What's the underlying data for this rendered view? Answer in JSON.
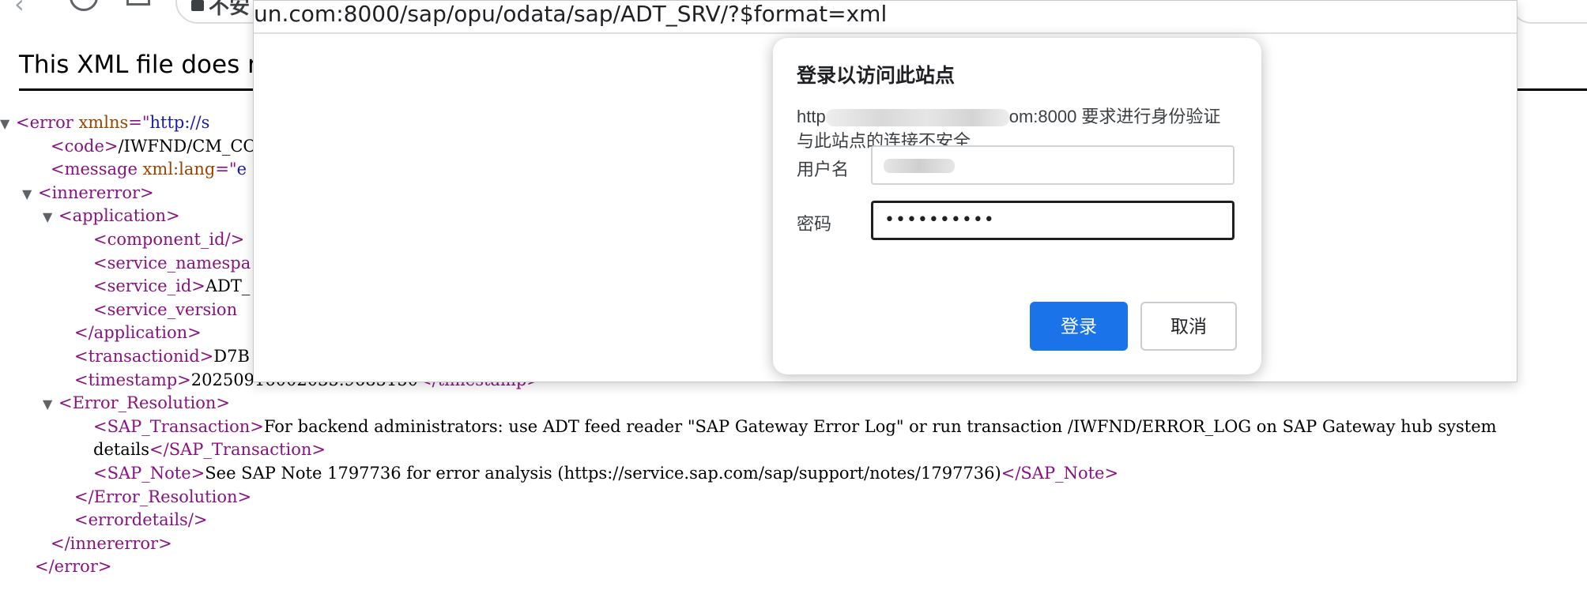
{
  "browser": {
    "omnibox_partial": "不安",
    "popup_url": "un.com:8000/sap/opu/odata/sap/ADT_SRV/?$format=xml"
  },
  "xml_viewer": {
    "header_visible": "This XML file does no",
    "lines": [
      {
        "twisty": "▼",
        "parts": [
          {
            "t": "<error ",
            "c": "tg"
          },
          {
            "t": "xmlns",
            "c": "at"
          },
          {
            "t": "=\"",
            "c": "tg"
          },
          {
            "t": "http://s",
            "c": "av"
          }
        ]
      },
      {
        "twisty": "",
        "parts": [
          {
            "t": "<code>",
            "c": "tg"
          },
          {
            "t": "/IWFND/CM_COS/",
            "c": ""
          }
        ]
      },
      {
        "twisty": "",
        "parts": [
          {
            "t": "<message ",
            "c": "tg"
          },
          {
            "t": "xml:lang",
            "c": "at"
          },
          {
            "t": "=\"",
            "c": "tg"
          },
          {
            "t": "e",
            "c": "av"
          }
        ]
      },
      {
        "twisty": "▼",
        "parts": [
          {
            "t": "<innererror>",
            "c": "tg"
          }
        ]
      },
      {
        "twisty": "▼",
        "parts": [
          {
            "t": "<application>",
            "c": "tg"
          }
        ]
      },
      {
        "twisty": "",
        "parts": [
          {
            "t": "<component_id/>",
            "c": "tg"
          }
        ]
      },
      {
        "twisty": "",
        "parts": [
          {
            "t": "<service_namespa",
            "c": "tg"
          }
        ]
      },
      {
        "twisty": "",
        "parts": [
          {
            "t": "<service_id>",
            "c": "tg"
          },
          {
            "t": "ADT_",
            "c": ""
          }
        ]
      },
      {
        "twisty": "",
        "parts": [
          {
            "t": "<service_version",
            "c": "tg"
          }
        ]
      },
      {
        "twisty": "",
        "parts": [
          {
            "t": "</application>",
            "c": "tg"
          }
        ]
      },
      {
        "twisty": "",
        "parts": [
          {
            "t": "<transactionid>",
            "c": "tg"
          },
          {
            "t": "D7B",
            "c": ""
          }
        ]
      },
      {
        "twisty": "",
        "parts": [
          {
            "t": "<timestamp>",
            "c": "tg"
          },
          {
            "t": "20250916002035.9685150",
            "c": ""
          },
          {
            "t": "</timestamp>",
            "c": "tg"
          }
        ]
      },
      {
        "twisty": "▼",
        "parts": [
          {
            "t": "<Error_Resolution>",
            "c": "tg"
          }
        ]
      },
      {
        "twisty": "",
        "parts": [
          {
            "t": "<SAP_Transaction>",
            "c": "tg"
          },
          {
            "t": "For backend administrators: use ADT feed reader \"SAP Gateway Error Log\" or run transaction /IWFND/ERROR_LOG on SAP Gateway hub system",
            "c": ""
          }
        ]
      },
      {
        "twisty": "",
        "parts": [
          {
            "t": "details",
            "c": ""
          },
          {
            "t": "</SAP_Transaction>",
            "c": "tg"
          }
        ]
      },
      {
        "twisty": "",
        "parts": [
          {
            "t": "<SAP_Note>",
            "c": "tg"
          },
          {
            "t": "See SAP Note 1797736 for error analysis (https://service.sap.com/sap/support/notes/1797736)",
            "c": ""
          },
          {
            "t": "</SAP_Note>",
            "c": "tg"
          }
        ]
      },
      {
        "twisty": "",
        "parts": [
          {
            "t": "</Error_Resolution>",
            "c": "tg"
          }
        ]
      },
      {
        "twisty": "",
        "parts": [
          {
            "t": "<errordetails/>",
            "c": "tg"
          }
        ]
      },
      {
        "twisty": "",
        "parts": [
          {
            "t": "</innererror>",
            "c": "tg"
          }
        ]
      },
      {
        "twisty": "",
        "parts": [
          {
            "t": "</error>",
            "c": "tg"
          }
        ]
      }
    ]
  },
  "login_dialog": {
    "title": "登录以访问此站点",
    "desc_prefix": "http",
    "desc_suffix": "om:8000 要求进行身份验证",
    "desc_line2": "与此站点的连接不安全",
    "username_label": "用户名",
    "password_label": "密码",
    "password_value": "••••••••••",
    "login_button": "登录",
    "cancel_button": "取消"
  },
  "colors": {
    "tag": "#881280",
    "attr_name": "#994500",
    "attr_value": "#1a1aa6",
    "primary_button": "#1a73e8"
  },
  "icons": [
    "back-arrow-icon",
    "reload-icon",
    "apps-icon",
    "lock-icon",
    "collapse-triangle-icon"
  ]
}
